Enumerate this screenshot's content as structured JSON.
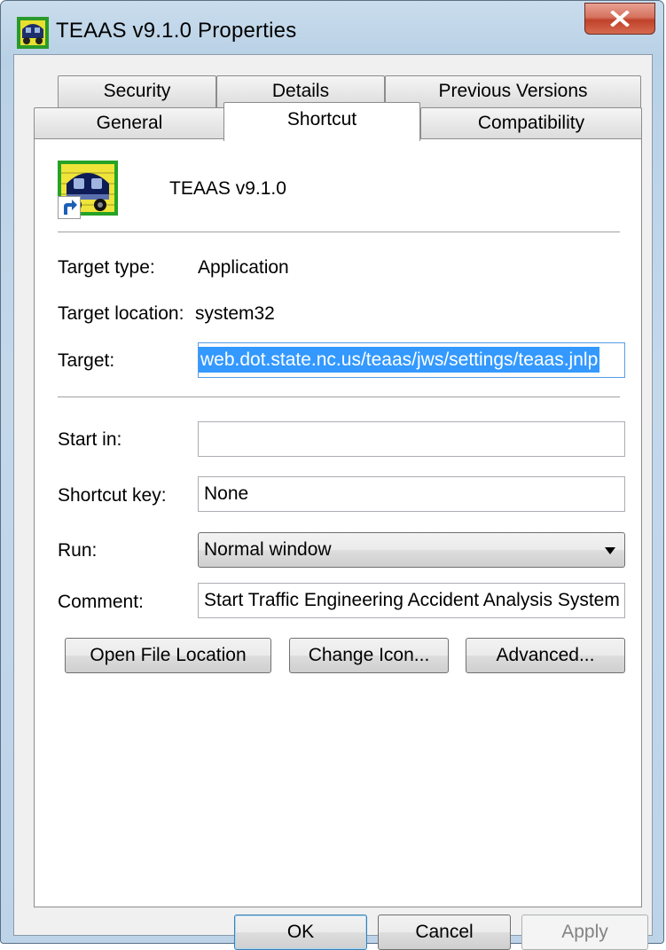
{
  "window": {
    "title": "TEAAS v9.1.0 Properties"
  },
  "tabs": {
    "row1": [
      {
        "label": "Security"
      },
      {
        "label": "Details"
      },
      {
        "label": "Previous Versions"
      }
    ],
    "row2": [
      {
        "label": "General"
      },
      {
        "label": "Shortcut",
        "active": true
      },
      {
        "label": "Compatibility"
      }
    ]
  },
  "header": {
    "name": "TEAAS v9.1.0"
  },
  "fields": {
    "target_type_label": "Target type:",
    "target_type_value": "Application",
    "target_location_label": "Target location:",
    "target_location_value": "system32",
    "target_label": "Target:",
    "target_value": "web.dot.state.nc.us/teaas/jws/settings/teaas.jnlp",
    "start_in_label": "Start in:",
    "start_in_value": "",
    "shortcut_key_label": "Shortcut key:",
    "shortcut_key_value": "None",
    "run_label": "Run:",
    "run_value": "Normal window",
    "comment_label": "Comment:",
    "comment_value": "Start Traffic Engineering Accident Analysis System"
  },
  "buttons": {
    "open_file_location": "Open File Location",
    "change_icon": "Change Icon...",
    "advanced": "Advanced...",
    "ok": "OK",
    "cancel": "Cancel",
    "apply": "Apply"
  },
  "colors": {
    "selection": "#3399ff",
    "close_button": "#c7503a",
    "frame": "#bfd4e8"
  },
  "icons": {
    "app_icon": "teaas-vehicle-icon",
    "shortcut_overlay": "shortcut-arrow-icon",
    "close": "close-icon",
    "dropdown": "chevron-down-icon"
  }
}
